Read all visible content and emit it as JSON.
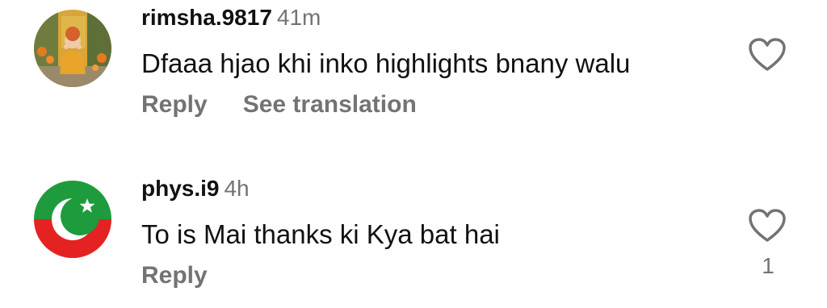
{
  "comments": [
    {
      "username": "rimsha.9817",
      "time": "41m",
      "text": "Dfaaa hjao khi inko highlights bnany walu",
      "actions": {
        "reply": "Reply",
        "translate": "See translation"
      },
      "like_count": ""
    },
    {
      "username": "phys.i9",
      "time": "4h",
      "text": "To is Mai thanks ki Kya bat hai",
      "actions": {
        "reply": "Reply"
      },
      "like_count": "1"
    }
  ],
  "icons": {
    "like": "heart-outline-icon"
  },
  "colors": {
    "secondary_text": "#737373",
    "primary_text": "#111111"
  }
}
